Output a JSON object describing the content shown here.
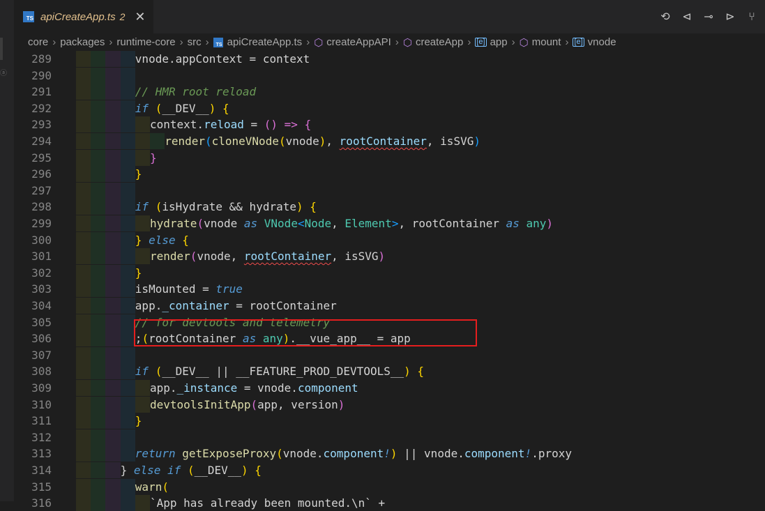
{
  "tab": {
    "badge": "TS",
    "title": "apiCreateApp.ts",
    "count": "2",
    "close_glyph": "✕"
  },
  "actions": [
    {
      "name": "timeline-history-icon",
      "glyph": "⟲"
    },
    {
      "name": "go-back-icon",
      "glyph": "⊲"
    },
    {
      "name": "git-commit-icon",
      "glyph": "⊸"
    },
    {
      "name": "go-forward-icon",
      "glyph": "⊳"
    },
    {
      "name": "source-control-icon",
      "glyph": "⑂"
    }
  ],
  "breadcrumb": [
    {
      "text": "core"
    },
    {
      "text": "packages"
    },
    {
      "text": "runtime-core"
    },
    {
      "text": "src"
    },
    {
      "text": "apiCreateApp.ts",
      "icon": "ts"
    },
    {
      "text": "createAppAPI",
      "icon": "cube"
    },
    {
      "text": "createApp",
      "icon": "cube"
    },
    {
      "text": "app",
      "icon": "var"
    },
    {
      "text": "mount",
      "icon": "cube"
    },
    {
      "text": "vnode",
      "icon": "var"
    }
  ],
  "breadcrumb_ts_badge": "TS",
  "breadcrumb_var_glyph": "[e]",
  "breadcrumb_cube_glyph": "⬡",
  "breadcrumb_separator": "›",
  "colors": {
    "editor_bg": "#1e1e1e",
    "tab_modified": "#e2c08d",
    "highlight_box": "#e51e1e",
    "ts_badge": "#3178c6"
  },
  "code_lines": [
    {
      "n": "289",
      "indent": 4,
      "tokens": [
        [
          "vnode.appContext = context",
          "p"
        ]
      ]
    },
    {
      "n": "290",
      "indent": 4,
      "tokens": []
    },
    {
      "n": "291",
      "indent": 4,
      "tokens": [
        [
          "// HMR root reload",
          "com"
        ]
      ]
    },
    {
      "n": "292",
      "indent": 4,
      "tokens": [
        [
          "if",
          "kw"
        ],
        [
          " (",
          "y"
        ],
        [
          "__DEV__",
          "p"
        ],
        [
          ") {",
          "y"
        ]
      ]
    },
    {
      "n": "293",
      "indent": 5,
      "tokens": [
        [
          "context.",
          "p"
        ],
        [
          "reload",
          "var"
        ],
        [
          " = ",
          "p"
        ],
        [
          "() => {",
          "p2"
        ]
      ]
    },
    {
      "n": "294",
      "indent": 6,
      "tokens": [
        [
          "render",
          "fn"
        ],
        [
          "(",
          "bl"
        ],
        [
          "cloneVNode",
          "fn"
        ],
        [
          "(",
          "y"
        ],
        [
          "vnode",
          "p"
        ],
        [
          ")",
          "y"
        ],
        [
          ", ",
          "p"
        ],
        [
          "rootContainer",
          "sq"
        ],
        [
          ", isSVG",
          "p"
        ],
        [
          ")",
          "bl"
        ]
      ]
    },
    {
      "n": "295",
      "indent": 5,
      "tokens": [
        [
          "}",
          "p2"
        ]
      ]
    },
    {
      "n": "296",
      "indent": 4,
      "tokens": [
        [
          "}",
          "y"
        ]
      ]
    },
    {
      "n": "297",
      "indent": 4,
      "tokens": []
    },
    {
      "n": "298",
      "indent": 4,
      "tokens": [
        [
          "if",
          "kw"
        ],
        [
          " (",
          "y"
        ],
        [
          "isHydrate && hydrate",
          "p"
        ],
        [
          ") {",
          "y"
        ]
      ]
    },
    {
      "n": "299",
      "indent": 5,
      "tokens": [
        [
          "hydrate",
          "fn"
        ],
        [
          "(",
          "p2"
        ],
        [
          "vnode ",
          "p"
        ],
        [
          "as",
          "kw"
        ],
        [
          " ",
          "p"
        ],
        [
          "VNode",
          "ty"
        ],
        [
          "<",
          "bl"
        ],
        [
          "Node",
          "ty"
        ],
        [
          ", ",
          "p"
        ],
        [
          "Element",
          "ty"
        ],
        [
          ">",
          "bl"
        ],
        [
          ", rootContainer ",
          "p"
        ],
        [
          "as",
          "kw"
        ],
        [
          " ",
          "p"
        ],
        [
          "any",
          "ty"
        ],
        [
          ")",
          "p2"
        ]
      ]
    },
    {
      "n": "300",
      "indent": 4,
      "tokens": [
        [
          "}",
          "y"
        ],
        [
          " ",
          "p"
        ],
        [
          "else",
          "kw"
        ],
        [
          " {",
          "y"
        ]
      ]
    },
    {
      "n": "301",
      "indent": 5,
      "tokens": [
        [
          "render",
          "fn"
        ],
        [
          "(",
          "p2"
        ],
        [
          "vnode, ",
          "p"
        ],
        [
          "rootContainer",
          "sq"
        ],
        [
          ", isSVG",
          "p"
        ],
        [
          ")",
          "p2"
        ]
      ]
    },
    {
      "n": "302",
      "indent": 4,
      "tokens": [
        [
          "}",
          "y"
        ]
      ]
    },
    {
      "n": "303",
      "indent": 4,
      "tokens": [
        [
          "isMounted",
          "p"
        ],
        [
          " = ",
          "p"
        ],
        [
          "true",
          "kw"
        ]
      ]
    },
    {
      "n": "304",
      "indent": 4,
      "tokens": [
        [
          "app.",
          "p"
        ],
        [
          "_container",
          "var"
        ],
        [
          " = rootContainer",
          "p"
        ]
      ]
    },
    {
      "n": "305",
      "indent": 4,
      "tokens": [
        [
          "// for devtools and telemetry",
          "com"
        ]
      ]
    },
    {
      "n": "306",
      "indent": 4,
      "tokens": [
        [
          ";",
          "p"
        ],
        [
          "(",
          "y"
        ],
        [
          "rootContainer ",
          "p"
        ],
        [
          "as",
          "kw"
        ],
        [
          " ",
          "p"
        ],
        [
          "any",
          "ty"
        ],
        [
          ")",
          "y"
        ],
        [
          ".__vue_app__ = app",
          "p"
        ]
      ]
    },
    {
      "n": "307",
      "indent": 4,
      "tokens": []
    },
    {
      "n": "308",
      "indent": 4,
      "tokens": [
        [
          "if",
          "kw"
        ],
        [
          " (",
          "y"
        ],
        [
          "__DEV__ || __FEATURE_PROD_DEVTOOLS__",
          "p"
        ],
        [
          ") {",
          "y"
        ]
      ]
    },
    {
      "n": "309",
      "indent": 5,
      "tokens": [
        [
          "app.",
          "p"
        ],
        [
          "_instance",
          "var"
        ],
        [
          " = vnode.",
          "p"
        ],
        [
          "component",
          "var"
        ]
      ]
    },
    {
      "n": "310",
      "indent": 5,
      "tokens": [
        [
          "devtoolsInitApp",
          "fn"
        ],
        [
          "(",
          "p2"
        ],
        [
          "app, version",
          "p"
        ],
        [
          ")",
          "p2"
        ]
      ]
    },
    {
      "n": "311",
      "indent": 4,
      "tokens": [
        [
          "}",
          "y"
        ]
      ]
    },
    {
      "n": "312",
      "indent": 4,
      "tokens": []
    },
    {
      "n": "313",
      "indent": 4,
      "tokens": [
        [
          "return",
          "kw"
        ],
        [
          " ",
          "p"
        ],
        [
          "getExposeProxy",
          "fn"
        ],
        [
          "(",
          "y"
        ],
        [
          "vnode.",
          "p"
        ],
        [
          "component",
          "var"
        ],
        [
          "!",
          "kw"
        ],
        [
          ")",
          "y"
        ],
        [
          " || vnode.",
          "p"
        ],
        [
          "component",
          "var"
        ],
        [
          "!",
          "kw"
        ],
        [
          ".proxy",
          "p"
        ]
      ]
    },
    {
      "n": "314",
      "indent": 3,
      "tokens": [
        [
          "}",
          "p"
        ],
        [
          " ",
          "p"
        ],
        [
          "else if",
          "kw"
        ],
        [
          " (",
          "y"
        ],
        [
          "__DEV__",
          "p"
        ],
        [
          ") {",
          "y"
        ]
      ]
    },
    {
      "n": "315",
      "indent": 4,
      "tokens": [
        [
          "warn",
          "fn"
        ],
        [
          "(",
          "y"
        ]
      ]
    },
    {
      "n": "316",
      "indent": 5,
      "tokens": [
        [
          "`App has already been mounted.\\n` +",
          "p"
        ]
      ]
    }
  ]
}
